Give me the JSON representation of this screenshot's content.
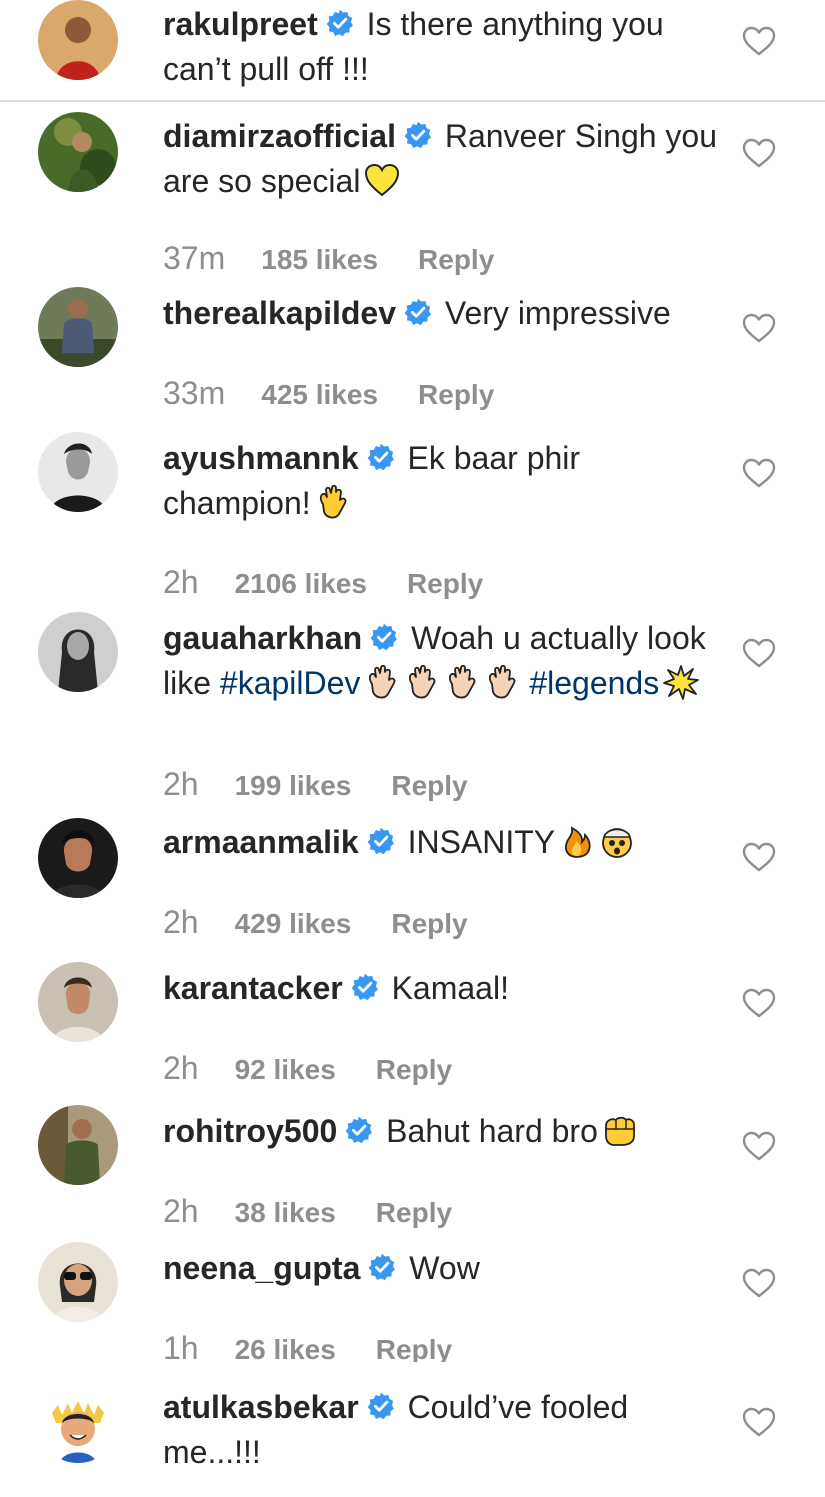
{
  "colors": {
    "badge": "#3897f0",
    "username": "#262626",
    "meta": "#8e8e8e",
    "hashtag": "#003569"
  },
  "comments": [
    {
      "username": "rakulpreet",
      "text": "Is there anything you can’t pull off !!!",
      "time": "",
      "likes": "",
      "reply": ""
    },
    {
      "username": "diamirzaofficial",
      "text": "Ranveer Singh you are so special",
      "emoji": "yellow-heart",
      "time": "37m",
      "likes": "185 likes",
      "reply": "Reply"
    },
    {
      "username": "therealkapildev",
      "text": "Very impressive",
      "time": "33m",
      "likes": "425 likes",
      "reply": "Reply"
    },
    {
      "username": "ayushmannk",
      "text": "Ek baar phir champion!",
      "emoji": "clapping-hands",
      "time": "2h",
      "likes": "2106 likes",
      "reply": "Reply"
    },
    {
      "username": "gauaharkhan",
      "text": "Woah u actually look like",
      "hashtag1": "#kapilDev",
      "hashtag2": "#legends",
      "emoji": "clapping-hands-x4, collision",
      "time": "2h",
      "likes": "199 likes",
      "reply": "Reply"
    },
    {
      "username": "armaanmalik",
      "text": "INSANITY",
      "emoji": "fire, exploding-head",
      "time": "2h",
      "likes": "429 likes",
      "reply": "Reply"
    },
    {
      "username": "karantacker",
      "text": "Kamaal!",
      "time": "2h",
      "likes": "92 likes",
      "reply": "Reply"
    },
    {
      "username": "rohitroy500",
      "text": "Bahut hard bro",
      "emoji": "oncoming-fist",
      "time": "2h",
      "likes": "38 likes",
      "reply": "Reply"
    },
    {
      "username": "neena_gupta",
      "text": "Wow",
      "time": "1h",
      "likes": "26 likes",
      "reply": "Reply"
    },
    {
      "username": "atulkasbekar",
      "text": "Could’ve fooled me...!!!",
      "time": "",
      "likes": "",
      "reply": ""
    }
  ]
}
